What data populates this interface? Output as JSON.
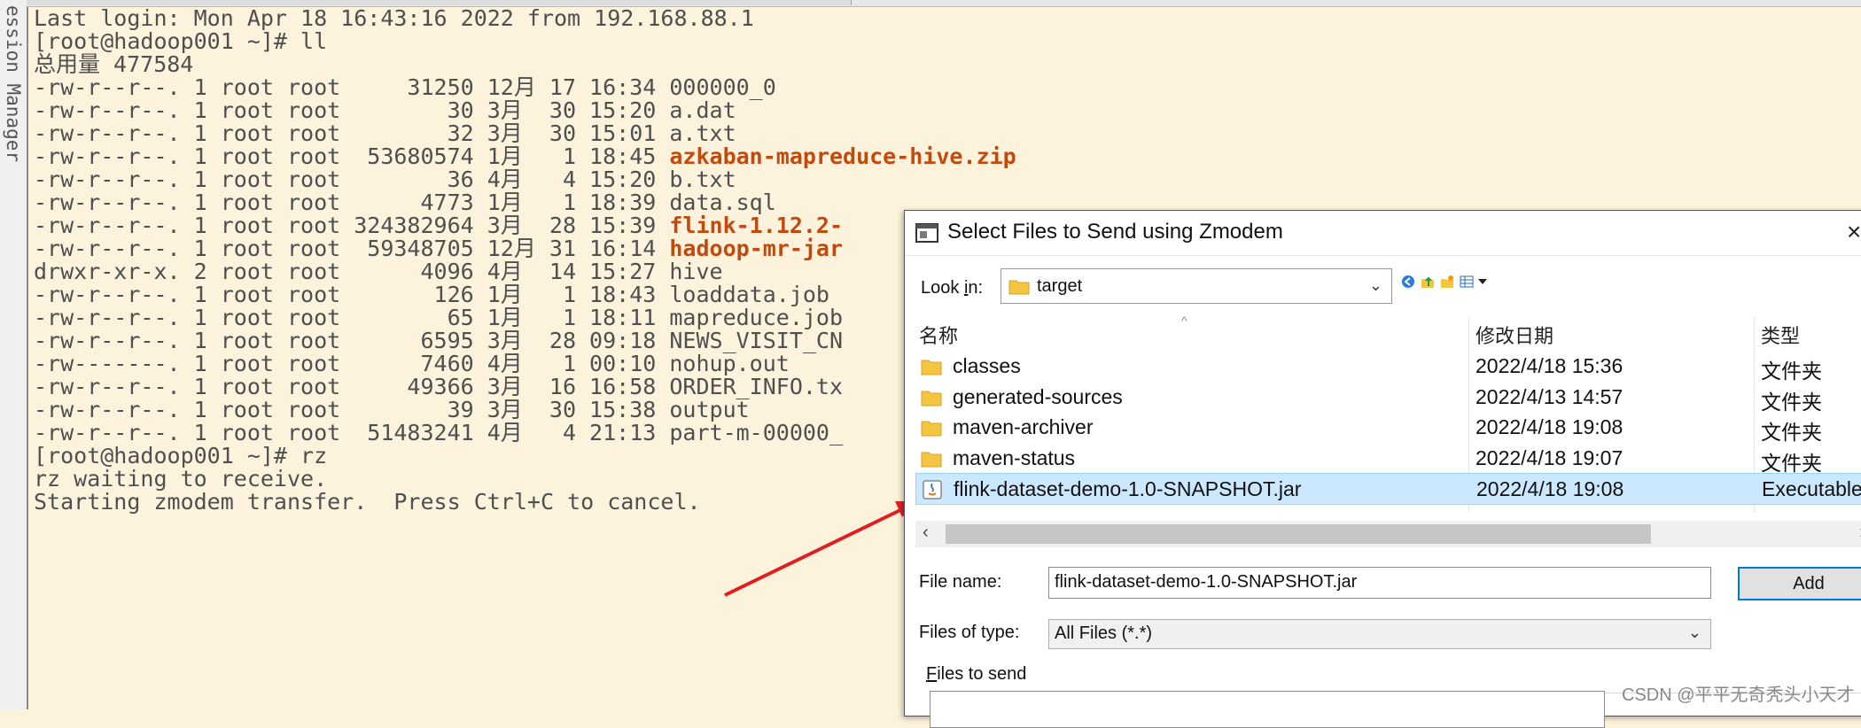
{
  "session_tab": {
    "label": "ession Manager"
  },
  "terminal": {
    "lines_before": [
      "Last login: Mon Apr 18 16:43:16 2022 from 192.168.88.1",
      "[root@hadoop001 ~]# ll",
      "总用量 477584"
    ],
    "listing": [
      {
        "prefix": "-rw-r--r--. 1 root root     31250 12月 17 16:34 ",
        "name": "000000_0",
        "bold": false
      },
      {
        "prefix": "-rw-r--r--. 1 root root        30 3月  30 15:20 ",
        "name": "a.dat",
        "bold": false
      },
      {
        "prefix": "-rw-r--r--. 1 root root        32 3月  30 15:01 ",
        "name": "a.txt",
        "bold": false
      },
      {
        "prefix": "-rw-r--r--. 1 root root  53680574 1月   1 18:45 ",
        "name": "azkaban-mapreduce-hive.zip",
        "bold": true
      },
      {
        "prefix": "-rw-r--r--. 1 root root        36 4月   4 15:20 ",
        "name": "b.txt",
        "bold": false
      },
      {
        "prefix": "-rw-r--r--. 1 root root      4773 1月   1 18:39 ",
        "name": "data.sql",
        "bold": false
      },
      {
        "prefix": "-rw-r--r--. 1 root root 324382964 3月  28 15:39 ",
        "name": "flink-1.12.2-",
        "bold": true
      },
      {
        "prefix": "-rw-r--r--. 1 root root  59348705 12月 31 16:14 ",
        "name": "hadoop-mr-jar",
        "bold": true
      },
      {
        "prefix": "drwxr-xr-x. 2 root root      4096 4月  14 15:27 ",
        "name": "hive",
        "bold": false
      },
      {
        "prefix": "-rw-r--r--. 1 root root       126 1月   1 18:43 ",
        "name": "loaddata.job",
        "bold": false
      },
      {
        "prefix": "-rw-r--r--. 1 root root        65 1月   1 18:11 ",
        "name": "mapreduce.job",
        "bold": false
      },
      {
        "prefix": "-rw-r--r--. 1 root root      6595 3月  28 09:18 ",
        "name": "NEWS_VISIT_CN",
        "bold": false
      },
      {
        "prefix": "-rw-------. 1 root root      7460 4月   1 00:10 ",
        "name": "nohup.out",
        "bold": false
      },
      {
        "prefix": "-rw-r--r--. 1 root root     49366 3月  16 16:58 ",
        "name": "ORDER_INFO.tx",
        "bold": false
      },
      {
        "prefix": "-rw-r--r--. 1 root root        39 3月  30 15:38 ",
        "name": "output",
        "bold": false
      },
      {
        "prefix": "-rw-r--r--. 1 root root  51483241 4月   4 21:13 ",
        "name": "part-m-00000_",
        "bold": false
      }
    ],
    "lines_after": [
      "[root@hadoop001 ~]# rz",
      "rz waiting to receive.",
      "Starting zmodem transfer.  Press Ctrl+C to cancel."
    ]
  },
  "dialog": {
    "title": "Select Files to Send using Zmodem",
    "close": "×",
    "lookin_label": "Look in:",
    "lookin_label_key": "i",
    "lookin_value": "target",
    "columns": {
      "name": "名称",
      "date": "修改日期",
      "type": "类型"
    },
    "rows": [
      {
        "name": "classes",
        "date": "2022/4/18 15:36",
        "type": "文件夹",
        "icon": "folder-icon",
        "selected": false
      },
      {
        "name": "generated-sources",
        "date": "2022/4/13 14:57",
        "type": "文件夹",
        "icon": "folder-icon",
        "selected": false
      },
      {
        "name": "maven-archiver",
        "date": "2022/4/18 19:08",
        "type": "文件夹",
        "icon": "folder-icon",
        "selected": false
      },
      {
        "name": "maven-status",
        "date": "2022/4/18 19:07",
        "type": "文件夹",
        "icon": "folder-icon",
        "selected": false
      },
      {
        "name": "flink-dataset-demo-1.0-SNAPSHOT.jar",
        "date": "2022/4/18 19:08",
        "type": "Executable",
        "icon": "java-jar-icon",
        "selected": true
      }
    ],
    "file_name_label": "File name:",
    "file_name_value": "flink-dataset-demo-1.0-SNAPSHOT.jar",
    "files_of_type_label": "Files of type:",
    "files_of_type_value": "All Files (*.*)",
    "add_label": "Add",
    "files_to_send_label": "Files to send"
  },
  "watermark": "CSDN @平平无奇秃头小天才",
  "colors": {
    "terminal_bg": "#fdf3dc",
    "terminal_text": "#4f4f4f",
    "archive_text": "#c24a0e",
    "selection_bg": "#cce8ff",
    "annotation_arrow": "#e02020"
  }
}
